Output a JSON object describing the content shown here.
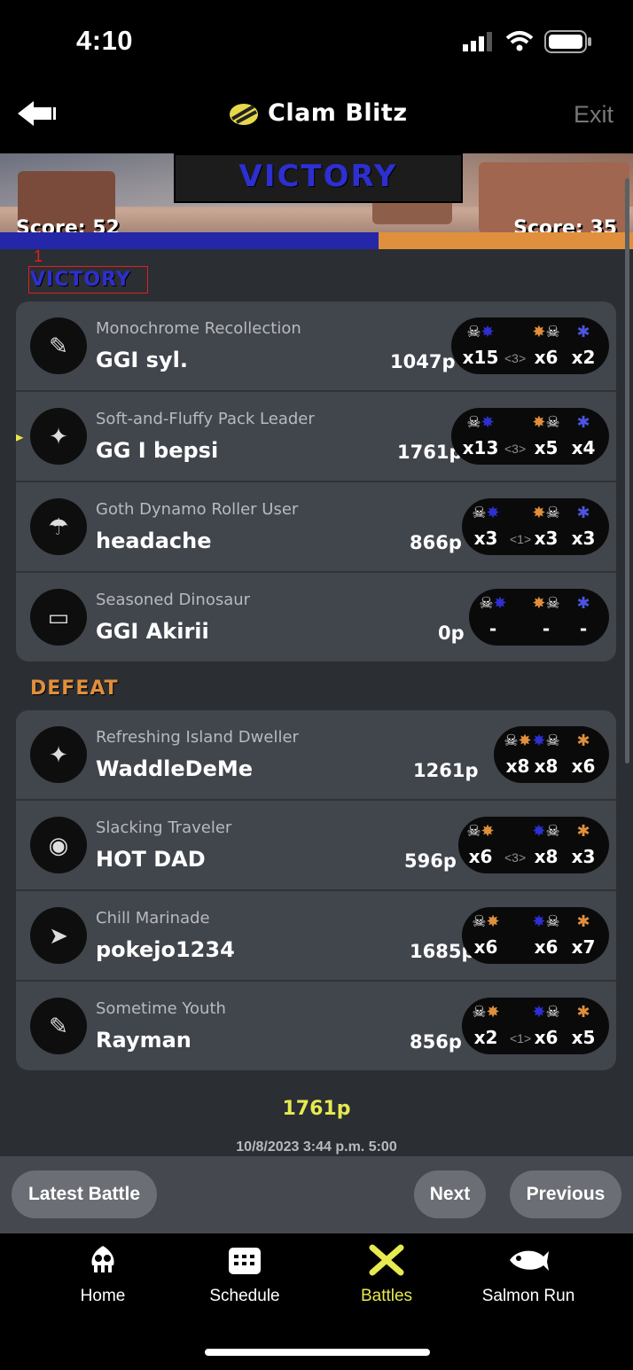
{
  "status_bar": {
    "time": "4:10"
  },
  "header": {
    "title": "Clam Blitz",
    "exit_label": "Exit",
    "back_icon": "back-arrow-icon",
    "mode_icon": "clam-blitz-icon"
  },
  "banner": {
    "result": "VICTORY",
    "score_left": "Score: 52",
    "score_right": "Score: 35",
    "score_left_value": 52,
    "score_right_value": 35
  },
  "annotation": {
    "number": "1"
  },
  "teams": [
    {
      "label": "VICTORY",
      "color": "#2d2fd0",
      "players": [
        {
          "title": "Monochrome Recollection",
          "name": "GGI syl.",
          "points": "1047p",
          "kills": "x15",
          "assists": "<3>",
          "deaths": "x6",
          "specials": "x2"
        },
        {
          "title": "Soft-and-Fluffy Pack Leader",
          "name": "GG I bepsi",
          "points": "1761p",
          "kills": "x13",
          "assists": "<3>",
          "deaths": "x5",
          "specials": "x4"
        },
        {
          "title": "Goth Dynamo Roller User",
          "name": "headache",
          "points": "866p",
          "kills": "x3",
          "assists": "<1>",
          "deaths": "x3",
          "specials": "x3"
        },
        {
          "title": "Seasoned Dinosaur",
          "name": "GGI Akirii",
          "points": "0p",
          "kills": "-",
          "assists": "",
          "deaths": "-",
          "specials": "-"
        }
      ]
    },
    {
      "label": "DEFEAT",
      "color": "#e08f3c",
      "players": [
        {
          "title": "Refreshing Island Dweller",
          "name": "WaddleDeMe",
          "points": "1261p",
          "kills": "x8",
          "assists": "",
          "deaths": "x8",
          "specials": "x6"
        },
        {
          "title": "Slacking Traveler",
          "name": "HOT DAD",
          "points": "596p",
          "kills": "x6",
          "assists": "<3>",
          "deaths": "x8",
          "specials": "x3"
        },
        {
          "title": "Chill Marinade",
          "name": "pokejo1234",
          "points": "1685p",
          "kills": "x6",
          "assists": "",
          "deaths": "x6",
          "specials": "x7"
        },
        {
          "title": "Sometime Youth",
          "name": "Rayman",
          "points": "856p",
          "kills": "x2",
          "assists": "<1>",
          "deaths": "x6",
          "specials": "x5"
        }
      ]
    }
  ],
  "footer": {
    "points": "1761p",
    "date": "10/8/2023 3:44 p.m. 5:00"
  },
  "buttons": {
    "latest": "Latest Battle",
    "next": "Next",
    "previous": "Previous"
  },
  "tabs": [
    {
      "label": "Home",
      "icon": "home-squid-icon",
      "active": false
    },
    {
      "label": "Schedule",
      "icon": "calendar-icon",
      "active": false
    },
    {
      "label": "Battles",
      "icon": "battles-icon",
      "active": true
    },
    {
      "label": "Salmon Run",
      "icon": "salmon-icon",
      "active": false
    }
  ],
  "colors": {
    "accent_active": "#e6ea4f",
    "alpha": "#2327a8",
    "bravo": "#e08f3c"
  }
}
